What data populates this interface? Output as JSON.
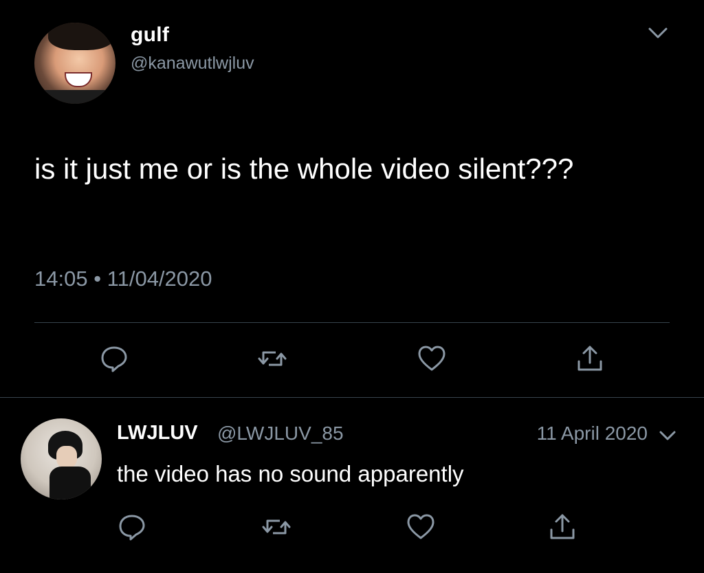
{
  "main_tweet": {
    "display_name": "gulf",
    "handle": "@kanawutlwjluv",
    "text": "is it just me or is the whole video silent???",
    "timestamp": "14:05 • 11/04/2020",
    "actions": [
      "reply-icon",
      "retweet-icon",
      "like-icon",
      "share-icon"
    ]
  },
  "reply": {
    "display_name": "LWJLUV",
    "handle": "@LWJLUV_85",
    "date": "11 April 2020",
    "text": "the video has no sound apparently",
    "actions": [
      "reply-icon",
      "retweet-icon",
      "like-icon",
      "share-icon"
    ]
  },
  "colors": {
    "background": "#000000",
    "primary_text": "#ffffff",
    "secondary_text": "#8b98a5",
    "divider": "#38444d"
  }
}
